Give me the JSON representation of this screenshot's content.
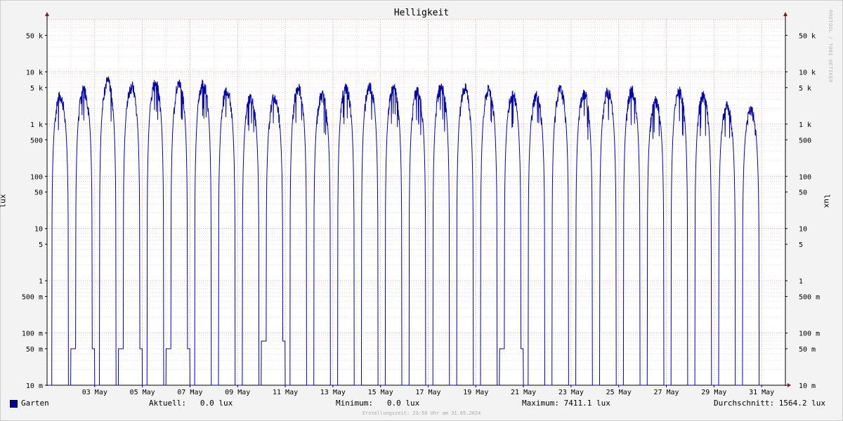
{
  "chart_data": {
    "type": "line",
    "title": "Helligkeit",
    "ylabel": "lux",
    "y_scale": "log",
    "ylim": [
      10,
      100000
    ],
    "y_ticks": [
      {
        "value": 50000,
        "label": "50 k"
      },
      {
        "value": 10000,
        "label": "10 k"
      },
      {
        "value": 5000,
        "label": "5 k"
      },
      {
        "value": 1000,
        "label": "1 k"
      },
      {
        "value": 500,
        "label": "500"
      },
      {
        "value": 100,
        "label": "100"
      },
      {
        "value": 50,
        "label": "50"
      },
      {
        "value": 10,
        "label": "10"
      },
      {
        "value": 5,
        "label": "5"
      },
      {
        "value": 1,
        "label": "1"
      },
      {
        "value": 0.5,
        "label": "500 m"
      },
      {
        "value": 0.1,
        "label": "100 m"
      },
      {
        "value": 0.05,
        "label": "50 m"
      },
      {
        "value": 0.01,
        "label": "10 m"
      }
    ],
    "x_ticks": [
      "03 May",
      "05 May",
      "07 May",
      "09 May",
      "11 May",
      "13 May",
      "15 May",
      "17 May",
      "19 May",
      "21 May",
      "23 May",
      "25 May",
      "27 May",
      "29 May",
      "31 May"
    ],
    "grid": true,
    "legend_position": "bottom-left",
    "series": [
      {
        "name": "Garten",
        "color": "#0000aa",
        "daily_peak_lux": [
          3800,
          5000,
          7400,
          5800,
          6900,
          6600,
          6700,
          4900,
          3600,
          3500,
          5500,
          3900,
          5400,
          5900,
          5400,
          4700,
          5800,
          5300,
          5000,
          4200,
          3900,
          5000,
          4300,
          4600,
          4800,
          3100,
          4600,
          3800,
          2400,
          2000
        ],
        "night_lux": [
          0.01,
          0.05,
          0.01,
          0.05,
          0.01,
          0.05,
          0.01,
          0.01,
          0.01,
          0.07,
          0.01,
          0.01,
          0.01,
          0.01,
          0.01,
          0.01,
          0.01,
          0.01,
          0.01,
          0.05,
          0.01,
          0.01,
          0.01,
          0.01,
          0.01,
          0.01,
          0.01,
          0.01,
          0.01,
          0.01
        ]
      }
    ]
  },
  "window": {
    "watermark": "RRDTOOL / TOBI OETIKER"
  },
  "legend": {
    "series_name": "Garten",
    "current": "Aktuell:   0.0 lux",
    "minimum": "Minimum:   0.0 lux",
    "maximum": "Maximum: 7411.1 lux",
    "average": "Durchschnitt: 1564.2 lux"
  },
  "footer": {
    "created": "Erstellungszeit: 23:58 Uhr am 31.05.2024"
  }
}
